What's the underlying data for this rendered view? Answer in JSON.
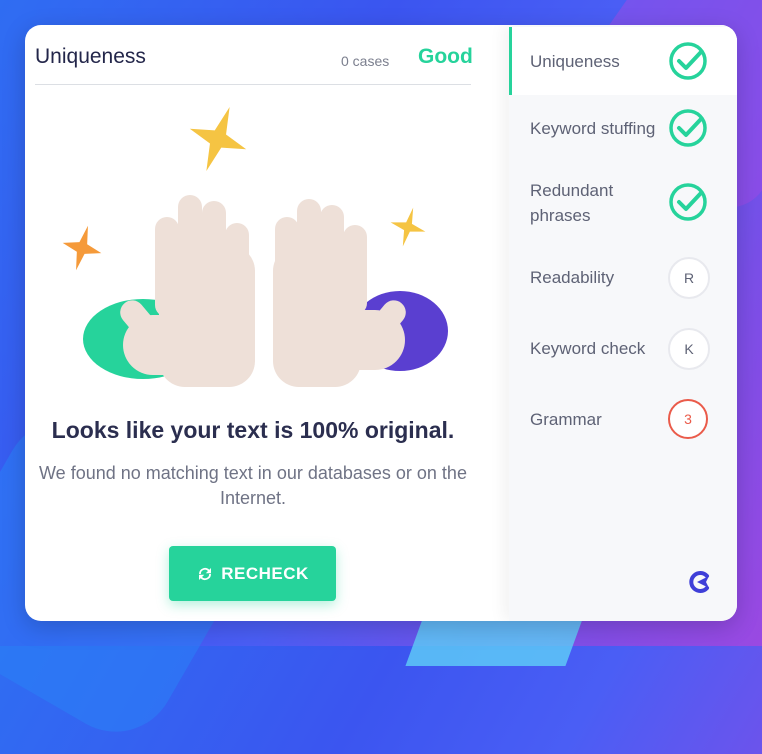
{
  "check": {
    "title": "Uniqueness",
    "cases": "0 cases",
    "status": "Good"
  },
  "result": {
    "headline": "Looks like your text is 100% original.",
    "description": "We found no matching text in our databases or on the Internet.",
    "recheck_label": "RECHECK"
  },
  "sidebar": {
    "items": [
      {
        "label": "Uniqueness",
        "state": "passed",
        "icon": "check-circle-icon"
      },
      {
        "label": "Keyword stuffing",
        "state": "passed",
        "icon": "check-circle-icon"
      },
      {
        "label": "Redundant phrases",
        "state": "passed",
        "icon": "check-circle-icon"
      },
      {
        "label": "Readability",
        "state": "pending",
        "badge": "R"
      },
      {
        "label": "Keyword check",
        "state": "pending",
        "badge": "K"
      },
      {
        "label": "Grammar",
        "state": "issues",
        "badge": "3"
      }
    ]
  },
  "colors": {
    "accent": "#26d39b",
    "error": "#ea5b4a",
    "purple": "#5a3fd0",
    "star_gold": "#f5c443",
    "star_orange": "#f59a3a",
    "title": "#23264a"
  }
}
